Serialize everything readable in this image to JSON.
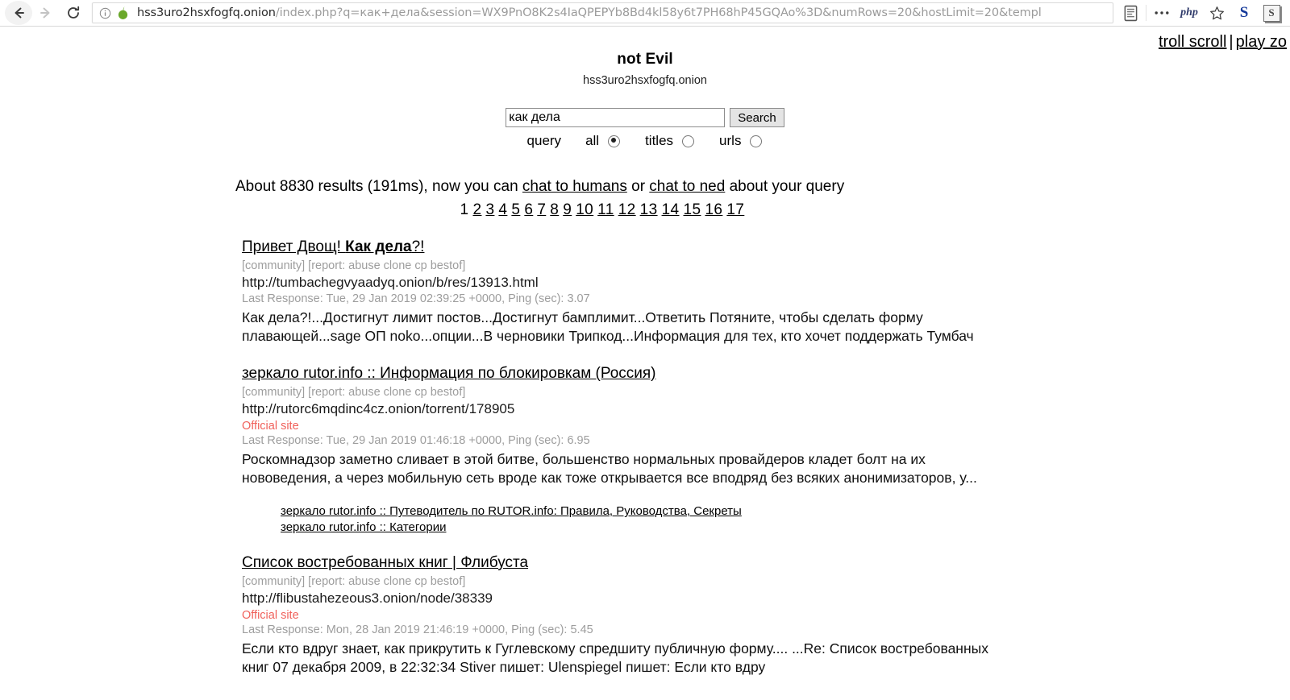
{
  "browser": {
    "back_label": "Back",
    "forward_label": "Forward",
    "reload_label": "Reload",
    "url_host": "hss3uro2hsxfogfq.onion",
    "url_path": "/index.php?q=как+дела&session=WX9PnO8K2s4IaQPEPYb8Bd4kl58y6t7PH68hP45GQAo%3D&numRows=20&hostLimit=20&templ",
    "security_icon": "info-icon",
    "site_icon": "onion-icon",
    "toolbar": {
      "reader_label": "Reader view",
      "overflow_label": "•••",
      "php_label": "php",
      "bookmark_label": "Bookmark",
      "ext1_label": "S",
      "ext2_label": "S"
    }
  },
  "page": {
    "top_links": [
      {
        "label": "troll scroll"
      },
      {
        "label": "play zo"
      }
    ],
    "top_links_separator": "|",
    "site_title": "not Evil",
    "site_subtitle": "hss3uro2hsxfogfq.onion",
    "search": {
      "value": "как дела",
      "placeholder": "",
      "button_label": "Search",
      "scope_label": "query",
      "options": [
        {
          "label": "all",
          "selected": true
        },
        {
          "label": "titles",
          "selected": false
        },
        {
          "label": "urls",
          "selected": false
        }
      ]
    },
    "summary": {
      "prefix": "About 8830 results (191ms), now you can ",
      "link1": "chat to humans",
      "middle": " or ",
      "link2": "chat to ned",
      "suffix": " about your query"
    },
    "pager": {
      "current": "1",
      "pages": [
        "2",
        "3",
        "4",
        "5",
        "6",
        "7",
        "8",
        "9",
        "10",
        "11",
        "12",
        "13",
        "14",
        "15",
        "16",
        "17"
      ]
    },
    "results": [
      {
        "title_plain_before": "Привет Двощ! ",
        "title_bold": "Как дела",
        "title_plain_after": "?!",
        "meta": "[community] [report: abuse clone cp bestof]",
        "url": "http://tumbachegvyaadyq.onion/b/res/13913.html",
        "official": "",
        "response": "Last Response: Tue, 29 Jan 2019 02:39:25 +0000, Ping (sec): 3.07",
        "snippet": "Как дела?!...Достигнут лимит постов...Достигнут бамплимит...Ответить Потяните, чтобы сделать форму плавающей...sage ОП noko...опции...В черновики Трипкод...Информация для тех, кто хочет поддержать Тумбач",
        "sublinks": []
      },
      {
        "title_plain_before": "зеркало rutor.info :: Информация по блокировкам (Россия)",
        "title_bold": "",
        "title_plain_after": "",
        "meta": "[community] [report: abuse clone cp bestof]",
        "url": "http://rutorc6mqdinc4cz.onion/torrent/178905",
        "official": "Official site",
        "response": "Last Response: Tue, 29 Jan 2019 01:46:18 +0000, Ping (sec): 6.95",
        "snippet": "Роскомнадзор заметно сливает в этой битве, большенство нормальных провайдеров кладет болт на их нововедения, а через мобильную сеть вроде как тоже открывается все вподряд без всяких анонимизаторов, у...",
        "sublinks": [
          "зеркало rutor.info :: Путеводитель по RUTOR.info: Правила, Руководства, Секреты",
          "зеркало rutor.info :: Категории"
        ]
      },
      {
        "title_plain_before": "Список востребованных книг | Флибуста",
        "title_bold": "",
        "title_plain_after": "",
        "meta": "[community] [report: abuse clone cp bestof]",
        "url": "http://flibustahezeous3.onion/node/38339",
        "official": "Official site",
        "response": "Last Response: Mon, 28 Jan 2019 21:46:19 +0000, Ping (sec): 5.45",
        "snippet": "Если кто вдруг знает, как прикрутить к Гуглевскому спредшиту публичную форму.... ...Re: Список востребованных книг  07 декабря 2009, в 22:32:34 Stiver пишет:  Ulenspiegel пишет:  Если кто вдру",
        "sublinks": []
      }
    ]
  },
  "colors": {
    "official_site": "#f0615b",
    "meta_grey": "#9d9d9d",
    "onion_green": "#6aa82a",
    "ext_blue": "#14399a"
  }
}
